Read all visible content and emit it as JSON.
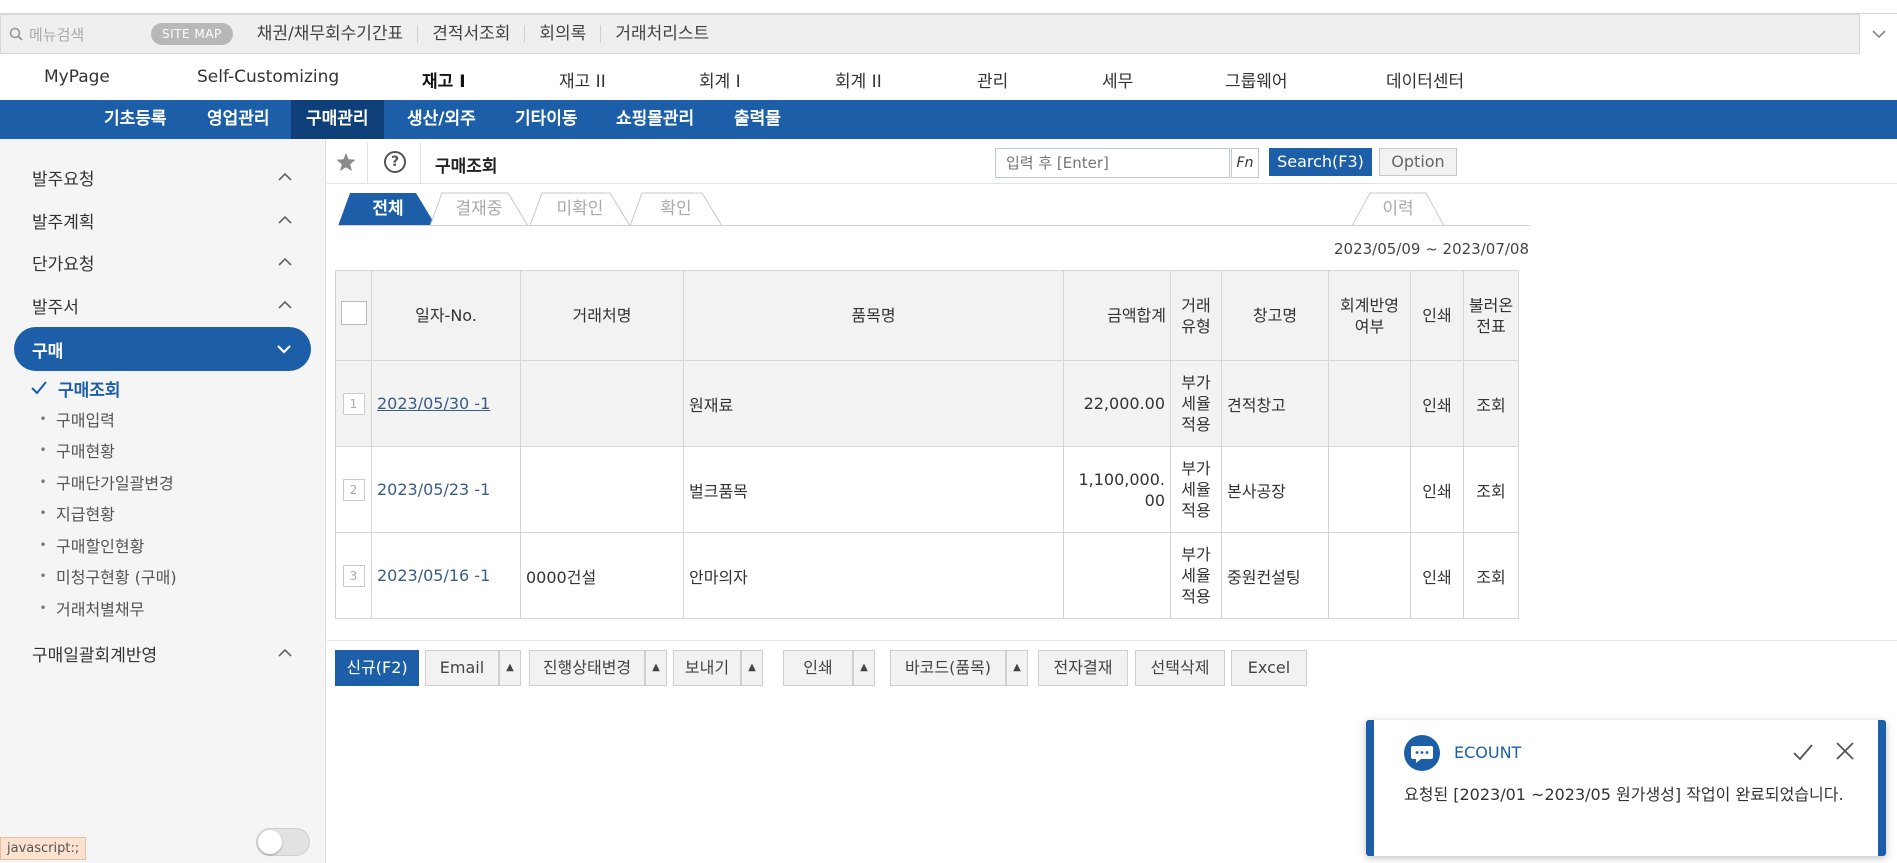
{
  "quickbar": {
    "search_placeholder": "메뉴검색",
    "sitemap": "SITE MAP",
    "links": [
      "채권/채무회수기간표",
      "견적서조회",
      "회의록",
      "거래처리스트"
    ]
  },
  "main_menu": [
    "MyPage",
    "Self-Customizing",
    "재고 I",
    "재고 II",
    "회계 I",
    "회계 II",
    "관리",
    "세무",
    "그룹웨어",
    "데이터센터"
  ],
  "main_menu_active": "재고 I",
  "sub_menu": [
    "기초등록",
    "영업관리",
    "구매관리",
    "생산/외주",
    "기타이동",
    "쇼핑몰관리",
    "출력물"
  ],
  "sub_menu_active": "구매관리",
  "sidebar": {
    "groups_top": [
      "발주요청",
      "발주계획",
      "단가요청",
      "발주서"
    ],
    "active_group": "구매",
    "items": [
      "구매조회",
      "구매입력",
      "구매현황",
      "구매단가일괄변경",
      "지급현황",
      "구매할인현황",
      "미청구현황 (구매)",
      "거래처별채무"
    ],
    "groups_bottom": [
      "구매일괄회계반영"
    ],
    "status_url": "javascript:;"
  },
  "header": {
    "title": "구매조회",
    "search_placeholder": "입력 후 [Enter]",
    "fn_label": "Fn",
    "search_button": "Search(F3)",
    "option_button": "Option"
  },
  "tabs": [
    "전체",
    "결재중",
    "미확인",
    "확인"
  ],
  "tab_history": "이력",
  "date_range": "2023/05/09 ~ 2023/07/08",
  "table": {
    "headers": [
      "일자-No.",
      "거래처명",
      "품목명",
      "금액합계",
      "거래유형",
      "창고명",
      "회계반영여부",
      "인쇄",
      "불러온 전표"
    ],
    "rows": [
      {
        "num": "1",
        "date": "2023/05/30 -1",
        "customer": "",
        "item": "원재료",
        "amount": "22,000.00",
        "type": "부가세율 적용",
        "warehouse": "견적창고",
        "acct": "",
        "print": "인쇄",
        "load": "조회"
      },
      {
        "num": "2",
        "date": "2023/05/23 -1",
        "customer": "",
        "item": "벌크품목",
        "amount": "1,100,000.00",
        "type": "부가세율 적용",
        "warehouse": "본사공장",
        "acct": "",
        "print": "인쇄",
        "load": "조회"
      },
      {
        "num": "3",
        "date": "2023/05/16 -1",
        "customer": "0000건설",
        "item": "안마의자",
        "amount": "",
        "type": "부가세율 적용",
        "warehouse": "중원컨설팅",
        "acct": "",
        "print": "인쇄",
        "load": "조회"
      }
    ]
  },
  "buttons": {
    "new": "신규(F2)",
    "email": "Email",
    "status_change": "진행상태변경",
    "send": "보내기",
    "print": "인쇄",
    "barcode": "바코드(품목)",
    "esign": "전자결재",
    "delete": "선택삭제",
    "excel": "Excel"
  },
  "toast": {
    "brand": "ECOUNT",
    "message": "요청된 [2023/01 ~2023/05 원가생성] 작업이 완료되었습니다."
  },
  "colors": {
    "primary": "#1c5fa8",
    "primary_dark": "#0e3f78"
  }
}
